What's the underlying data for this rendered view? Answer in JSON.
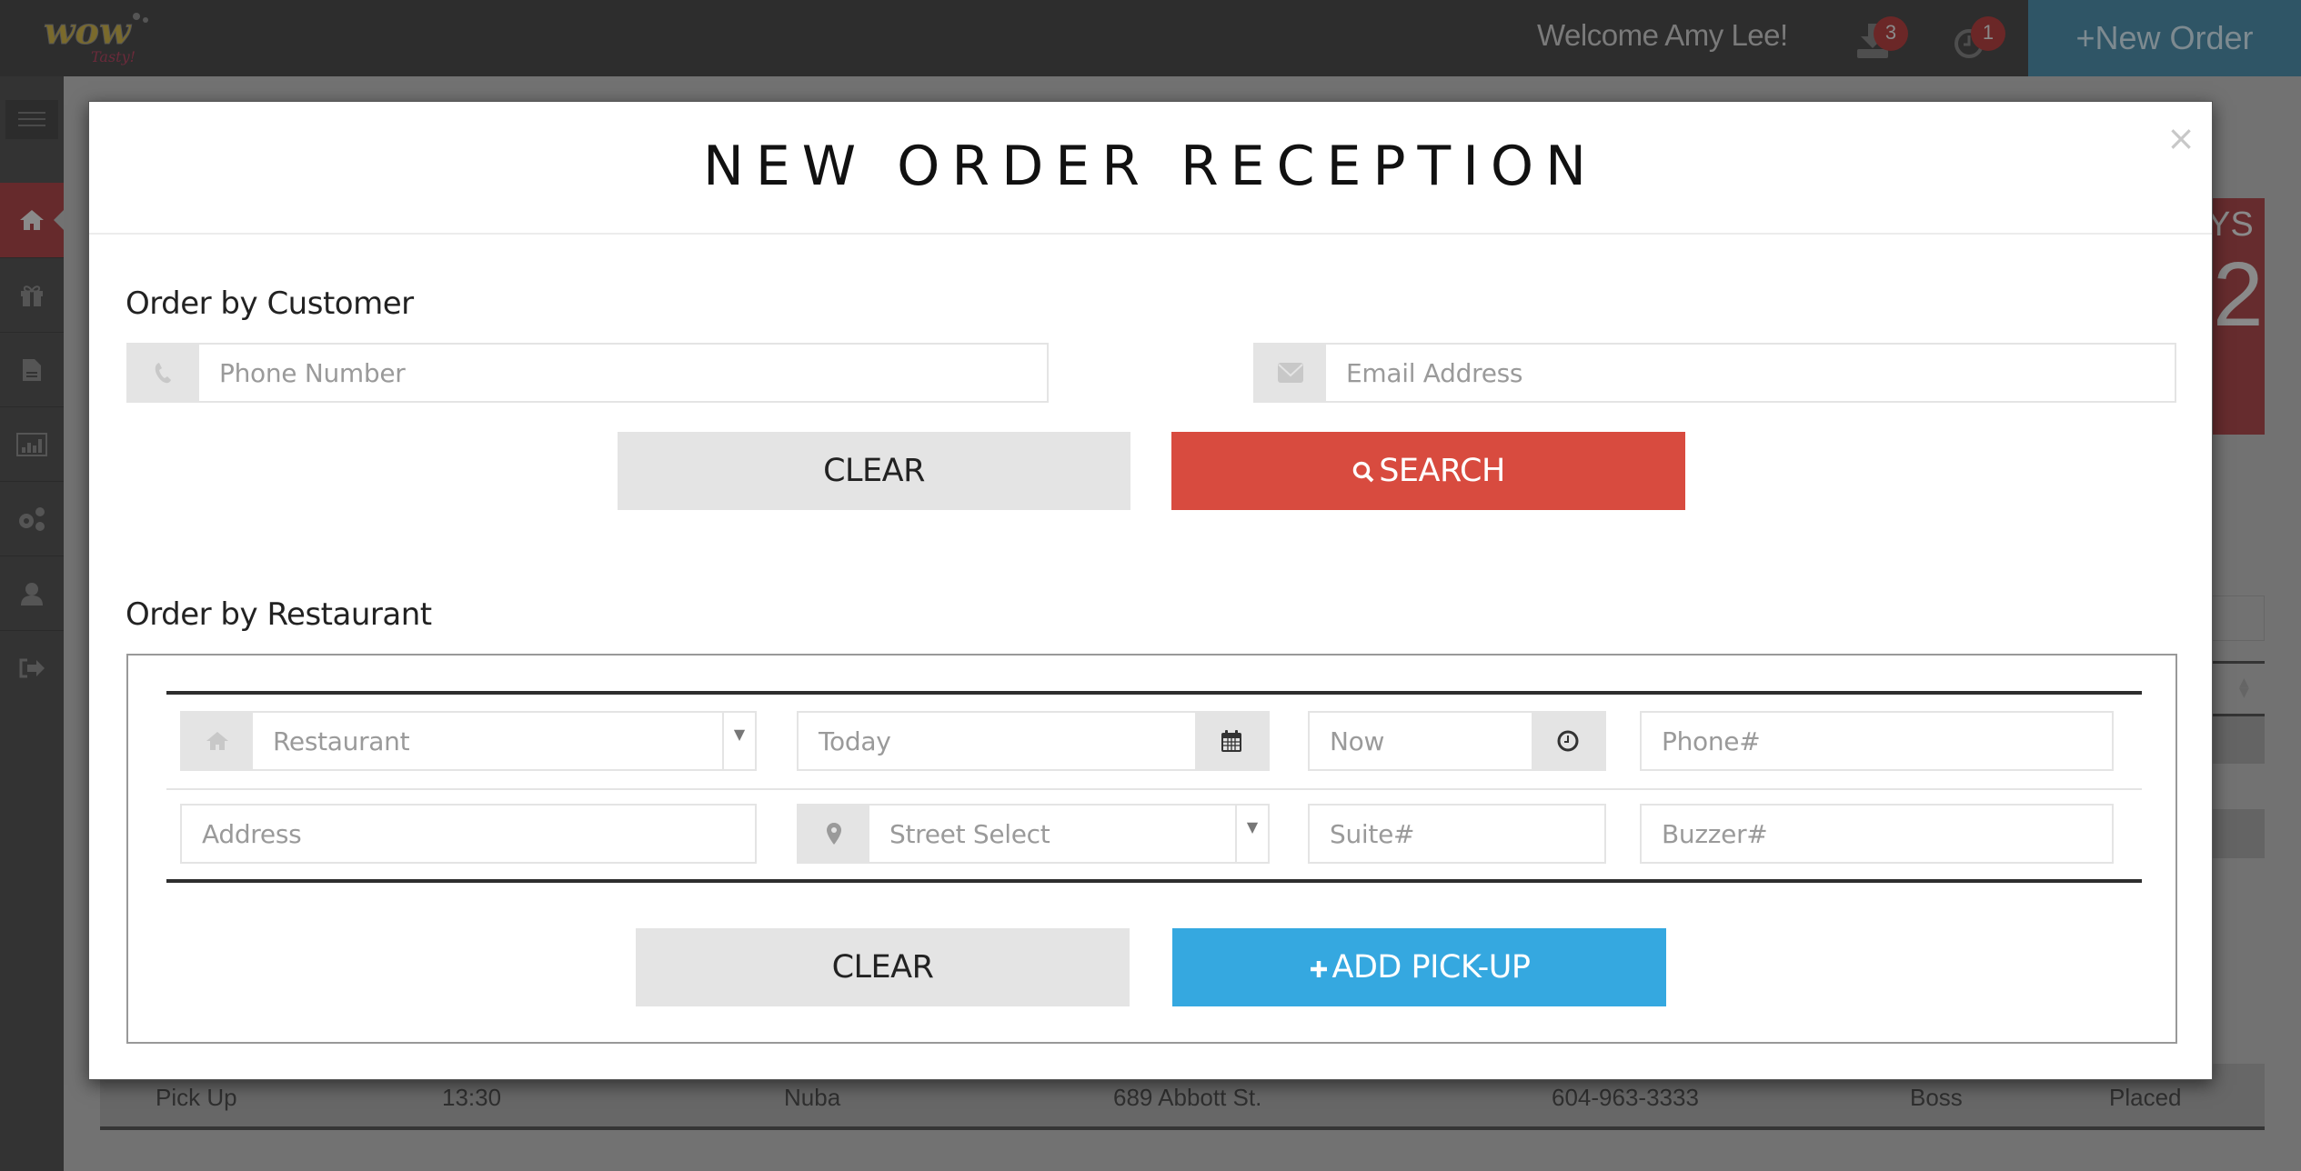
{
  "topbar": {
    "welcome": "Welcome Amy Lee!",
    "notifications": [
      {
        "icon": "download-icon",
        "count": "3"
      },
      {
        "icon": "clock-icon",
        "count": "1"
      }
    ],
    "new_order_label": "+New Order"
  },
  "sidebar": {
    "items": [
      {
        "name": "home",
        "icon": "home-icon",
        "active": true
      },
      {
        "name": "gifts",
        "icon": "gift-icon"
      },
      {
        "name": "documents",
        "icon": "file-icon"
      },
      {
        "name": "reports",
        "icon": "bar-chart-icon"
      },
      {
        "name": "settings",
        "icon": "cogs-icon"
      },
      {
        "name": "profile",
        "icon": "user-icon"
      },
      {
        "name": "logout",
        "icon": "sign-out-icon"
      }
    ]
  },
  "background": {
    "card_label_fragment": "YS",
    "card_value_fragment": "2",
    "row": {
      "type": "Pick Up",
      "time": "13:30",
      "restaurant": "Nuba",
      "address": "689 Abbott St.",
      "phone": "604-963-3333",
      "driver": "Boss",
      "status": "Placed"
    }
  },
  "modal": {
    "title": "NEW ORDER RECEPTION",
    "close": "×",
    "customer": {
      "label": "Order by Customer",
      "phone_placeholder": "Phone Number",
      "email_placeholder": "Email Address",
      "clear_label": "CLEAR",
      "search_label": "SEARCH"
    },
    "restaurant": {
      "label": "Order by Restaurant",
      "restaurant_select": "Restaurant",
      "date_value": "Today",
      "time_value": "Now",
      "phone_placeholder": "Phone#",
      "address_placeholder": "Address",
      "street_select": "Street Select",
      "suite_placeholder": "Suite#",
      "buzzer_placeholder": "Buzzer#",
      "clear_label": "CLEAR",
      "add_label": "ADD PICK-UP"
    }
  },
  "colors": {
    "search": "#d84b3f",
    "add_pickup": "#35a8e0",
    "sidebar_active": "#c9403f"
  }
}
